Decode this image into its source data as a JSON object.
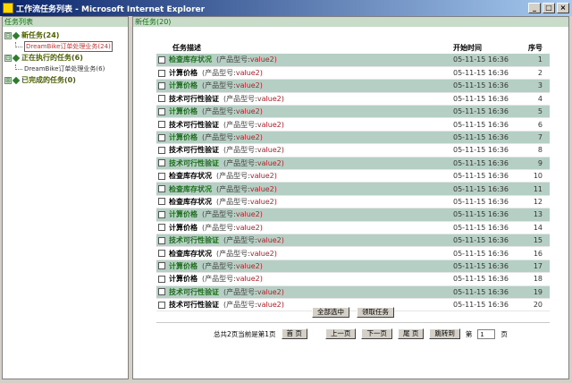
{
  "window": {
    "title": "工作流任务列表 - Microsoft Internet Explorer",
    "btn_min": "_",
    "btn_max": "□",
    "btn_close": "×"
  },
  "left": {
    "header": "任务列表",
    "tree": [
      {
        "label": "新任务(24)",
        "toggle": "⊟",
        "children": [
          {
            "label": "DreamBike订单处理业务(24)",
            "selected": true
          }
        ]
      },
      {
        "label": "正在执行的任务(6)",
        "toggle": "⊟",
        "children": [
          {
            "label": "DreamBike订单处理业务(6)",
            "selected": false
          }
        ]
      },
      {
        "label": "已完成的任务(0)",
        "toggle": "⊞",
        "children": []
      }
    ]
  },
  "right": {
    "header": "新任务(20)",
    "columns": {
      "task": "任务描述",
      "time": "开始时间",
      "num": "序号"
    },
    "rows": [
      {
        "name": "检查库存状况",
        "param": "(产品型号:",
        "value": "value2)",
        "time": "05-11-15 16:36",
        "num": "1"
      },
      {
        "name": "计算价格",
        "param": "(产品型号:",
        "value": "value2)",
        "time": "05-11-15 16:36",
        "num": "2"
      },
      {
        "name": "计算价格",
        "param": "(产品型号:",
        "value": "value2)",
        "time": "05-11-15 16:36",
        "num": "3"
      },
      {
        "name": "技术可行性验证",
        "param": "(产品型号:",
        "value": "value2)",
        "time": "05-11-15 16:36",
        "num": "4"
      },
      {
        "name": "计算价格",
        "param": "(产品型号:",
        "value": "value2)",
        "time": "05-11-15 16:36",
        "num": "5"
      },
      {
        "name": "技术可行性验证",
        "param": "(产品型号:",
        "value": "value2)",
        "time": "05-11-15 16:36",
        "num": "6"
      },
      {
        "name": "计算价格",
        "param": "(产品型号:",
        "value": "value2)",
        "time": "05-11-15 16:36",
        "num": "7"
      },
      {
        "name": "技术可行性验证",
        "param": "(产品型号:",
        "value": "value2)",
        "time": "05-11-15 16:36",
        "num": "8"
      },
      {
        "name": "技术可行性验证",
        "param": "(产品型号:",
        "value": "value2)",
        "time": "05-11-15 16:36",
        "num": "9"
      },
      {
        "name": "检查库存状况",
        "param": "(产品型号:",
        "value": "value2)",
        "time": "05-11-15 16:36",
        "num": "10"
      },
      {
        "name": "检查库存状况",
        "param": "(产品型号:",
        "value": "value2)",
        "time": "05-11-15 16:36",
        "num": "11"
      },
      {
        "name": "检查库存状况",
        "param": "(产品型号:",
        "value": "value2)",
        "time": "05-11-15 16:36",
        "num": "12"
      },
      {
        "name": "计算价格",
        "param": "(产品型号:",
        "value": "value2)",
        "time": "05-11-15 16:36",
        "num": "13"
      },
      {
        "name": "计算价格",
        "param": "(产品型号:",
        "value": "value2)",
        "time": "05-11-15 16:36",
        "num": "14"
      },
      {
        "name": "技术可行性验证",
        "param": "(产品型号:",
        "value": "value2)",
        "time": "05-11-15 16:36",
        "num": "15"
      },
      {
        "name": "检查库存状况",
        "param": "(产品型号:",
        "value": "value2)",
        "time": "05-11-15 16:36",
        "num": "16"
      },
      {
        "name": "计算价格",
        "param": "(产品型号:",
        "value": "value2)",
        "time": "05-11-15 16:36",
        "num": "17"
      },
      {
        "name": "计算价格",
        "param": "(产品型号:",
        "value": "value2)",
        "time": "05-11-15 16:36",
        "num": "18"
      },
      {
        "name": "技术可行性验证",
        "param": "(产品型号:",
        "value": "value2)",
        "time": "05-11-15 16:36",
        "num": "19"
      },
      {
        "name": "技术可行性验证",
        "param": "(产品型号:",
        "value": "value2)",
        "time": "05-11-15 16:36",
        "num": "20"
      }
    ],
    "select_all": "全部选中",
    "claim": "领取任务"
  },
  "pager": {
    "summary": "总共2页当前是第1页",
    "first": "首 页",
    "prev": "上一页",
    "next": "下一页",
    "last": "尾 页",
    "goto": "跳转到",
    "goto_prefix": "第",
    "page_value": "1",
    "goto_suffix": "页"
  },
  "colors": {
    "header_bg": "#c9dcc9",
    "row_alt": "#b6cfc4",
    "value_red": "#b0202a"
  }
}
